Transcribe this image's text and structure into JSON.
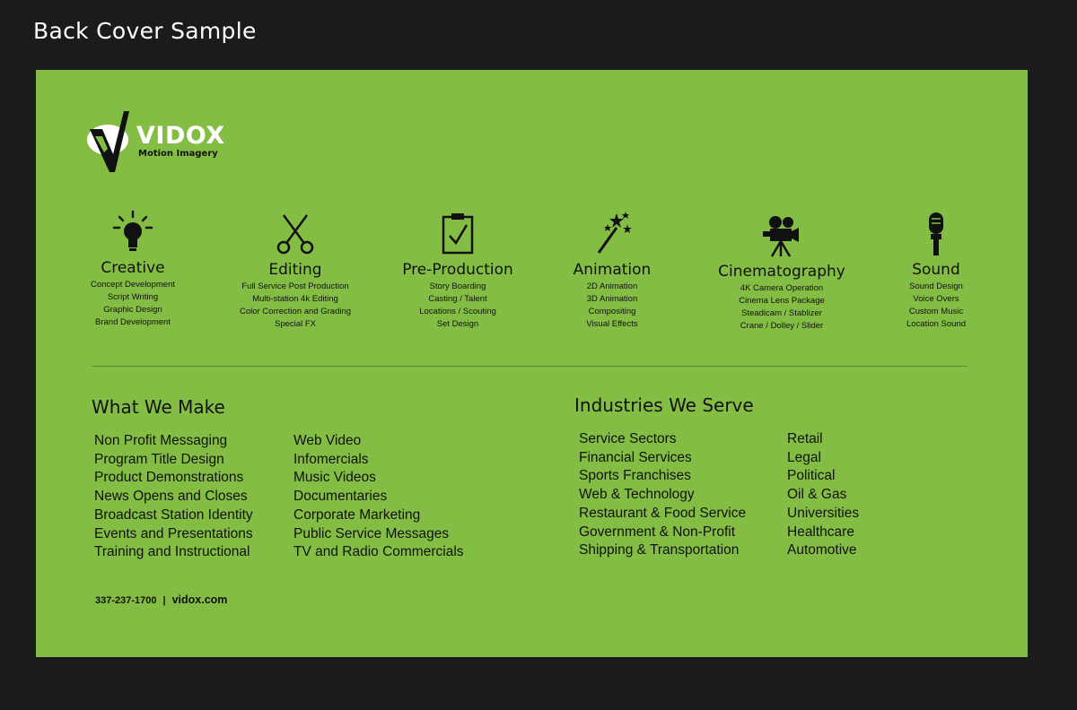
{
  "page": {
    "title": "Back Cover Sample"
  },
  "logo": {
    "name": "VIDOX",
    "tagline": "Motion Imagery"
  },
  "services": [
    {
      "title": "Creative",
      "icon": "lightbulb-icon",
      "items": [
        "Concept Development",
        "Script Writing",
        "Graphic Design",
        "Brand Development"
      ]
    },
    {
      "title": "Editing",
      "icon": "scissors-icon",
      "items": [
        "Full Service Post Production",
        "Multi-station 4k Editing",
        "Color Correction and Grading",
        "Special FX"
      ]
    },
    {
      "title": "Pre-Production",
      "icon": "clipboard-check-icon",
      "items": [
        "Story Boarding",
        "Casting / Talent",
        "Locations / Scouting",
        "Set Design"
      ]
    },
    {
      "title": "Animation",
      "icon": "magic-wand-icon",
      "items": [
        "2D Animation",
        "3D Animation",
        "Compositing",
        "Visual Effects"
      ]
    },
    {
      "title": "Cinematography",
      "icon": "movie-camera-icon",
      "items": [
        "4K Camera Operation",
        "Cinema Lens Package",
        "Steadicam / Stablizer",
        "Crane / Dolley / Slider"
      ]
    },
    {
      "title": "Sound",
      "icon": "microphone-icon",
      "items": [
        "Sound Design",
        "Voice Overs",
        "Custom Music",
        "Location Sound"
      ]
    }
  ],
  "what_we_make": {
    "heading": "What We Make",
    "col1": [
      "Non Profit Messaging",
      "Program Title Design",
      "Product Demonstrations",
      "News Opens and Closes",
      "Broadcast Station Identity",
      "Events and Presentations",
      "Training and Instructional"
    ],
    "col2": [
      "Web Video",
      "Infomercials",
      "Music Videos",
      "Documentaries",
      "Corporate Marketing",
      "Public Service Messages",
      "TV and Radio Commercials"
    ]
  },
  "industries": {
    "heading": "Industries We Serve",
    "col1": [
      "Service Sectors",
      "Financial Services",
      "Sports Franchises",
      "Web & Technology",
      "Restaurant & Food Service",
      "Government & Non-Profit",
      "Shipping & Transportation"
    ],
    "col2": [
      "Retail",
      "Legal",
      "Political",
      "Oil & Gas",
      "Universities",
      "Healthcare",
      "Automotive"
    ]
  },
  "contact": {
    "phone": "337-237-1700",
    "separator": "|",
    "website": "vidox.com"
  },
  "colors": {
    "background": "#1b1b1b",
    "cover": "#84bd44",
    "ink": "#111111"
  }
}
